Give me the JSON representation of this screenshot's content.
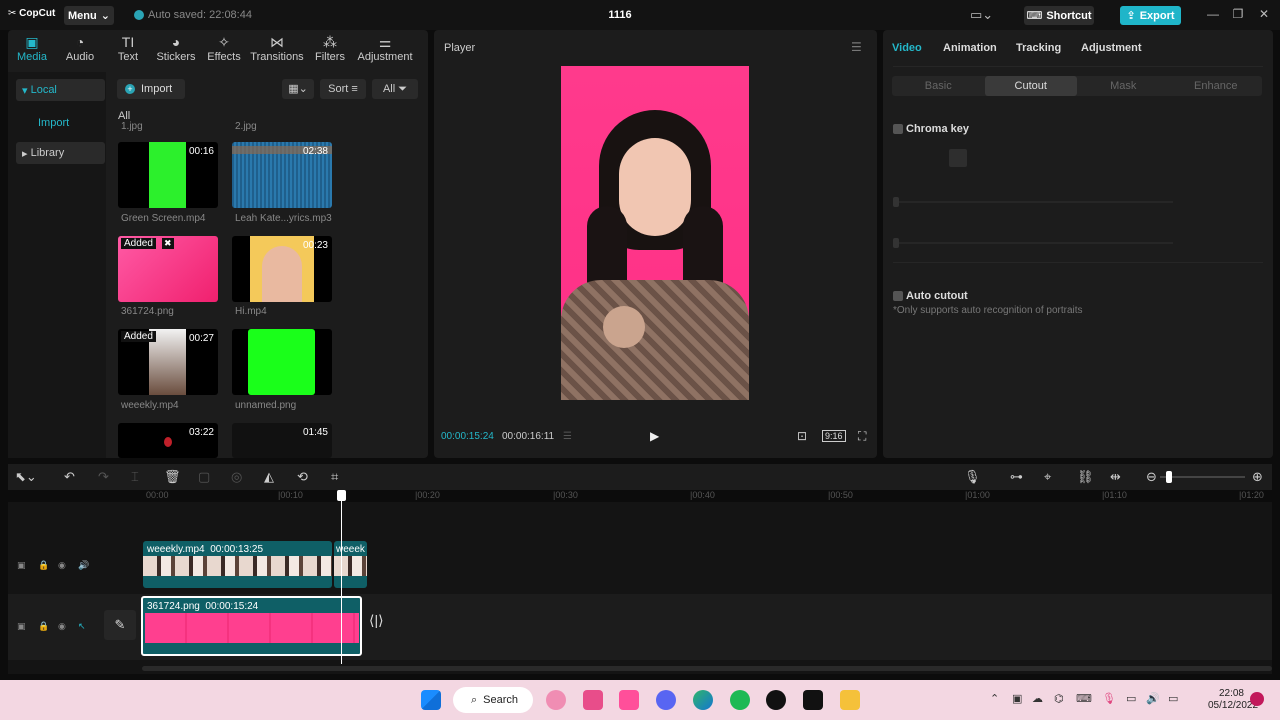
{
  "titlebar": {
    "app_name": "CopCut",
    "menu_label": "Menu",
    "autosave_text": "Auto saved: 22:08:44",
    "project_title": "1116",
    "shortcut_label": "Shortcut",
    "export_label": "Export"
  },
  "media_tabs": [
    {
      "label": "Media",
      "icon": "media-icon",
      "active": true
    },
    {
      "label": "Audio",
      "icon": "audio-icon"
    },
    {
      "label": "Text",
      "icon": "text-icon"
    },
    {
      "label": "Stickers",
      "icon": "stickers-icon"
    },
    {
      "label": "Effects",
      "icon": "effects-icon"
    },
    {
      "label": "Transitions",
      "icon": "transitions-icon"
    },
    {
      "label": "Filters",
      "icon": "filters-icon"
    },
    {
      "label": "Adjustment",
      "icon": "adjustment-icon"
    }
  ],
  "sidebar": {
    "local": "Local",
    "import": "Import",
    "library": "Library"
  },
  "media_toolbar": {
    "import_label": "Import",
    "sort_label": "Sort",
    "all_label": "All"
  },
  "media": {
    "all_label": "All",
    "prev_row": [
      "1.jpg",
      "2.jpg"
    ],
    "items": [
      {
        "name": "Green Screen.mp4",
        "duration": "00:16"
      },
      {
        "name": "Leah Kate...yrics.mp3",
        "duration": "02:38"
      },
      {
        "name": "361724.png",
        "added": "Added"
      },
      {
        "name": "Hi.mp4",
        "duration": "00:23"
      },
      {
        "name": "weeekly.mp4",
        "duration": "00:27",
        "added": "Added"
      },
      {
        "name": "unnamed.png"
      },
      {
        "name": "",
        "duration": "03:22"
      },
      {
        "name": "",
        "duration": "01:45"
      }
    ]
  },
  "player": {
    "title": "Player",
    "current_time": "00:00:15:24",
    "total_time": "00:00:16:11",
    "ratio": "9:16"
  },
  "right_panel": {
    "tabs": [
      "Video",
      "Animation",
      "Tracking",
      "Adjustment"
    ],
    "subtabs": [
      "Basic",
      "Cutout",
      "Mask",
      "Enhance"
    ],
    "chroma_key": "Chroma key",
    "auto_cutout": "Auto cutout",
    "auto_cutout_note": "*Only supports auto recognition of portraits"
  },
  "timeline": {
    "ticks": [
      "00:00",
      "|00:10",
      "|00:20",
      "|00:30",
      "|00:40",
      "|00:50",
      "|01:00",
      "|01:10",
      "|01:20"
    ],
    "clip1_name": "weeekly.mp4",
    "clip1_duration": "00:00:13:25",
    "clip1b_name": "weeek",
    "clip2_name": "361724.png",
    "clip2_duration": "00:00:15:24"
  },
  "taskbar": {
    "search_label": "Search",
    "time": "22:08",
    "date": "05/12/2022"
  },
  "colors": {
    "accent": "#24b8ca",
    "export": "#1fb5c9",
    "clip": "#0f5f66",
    "pink": "#ff3f8f"
  }
}
